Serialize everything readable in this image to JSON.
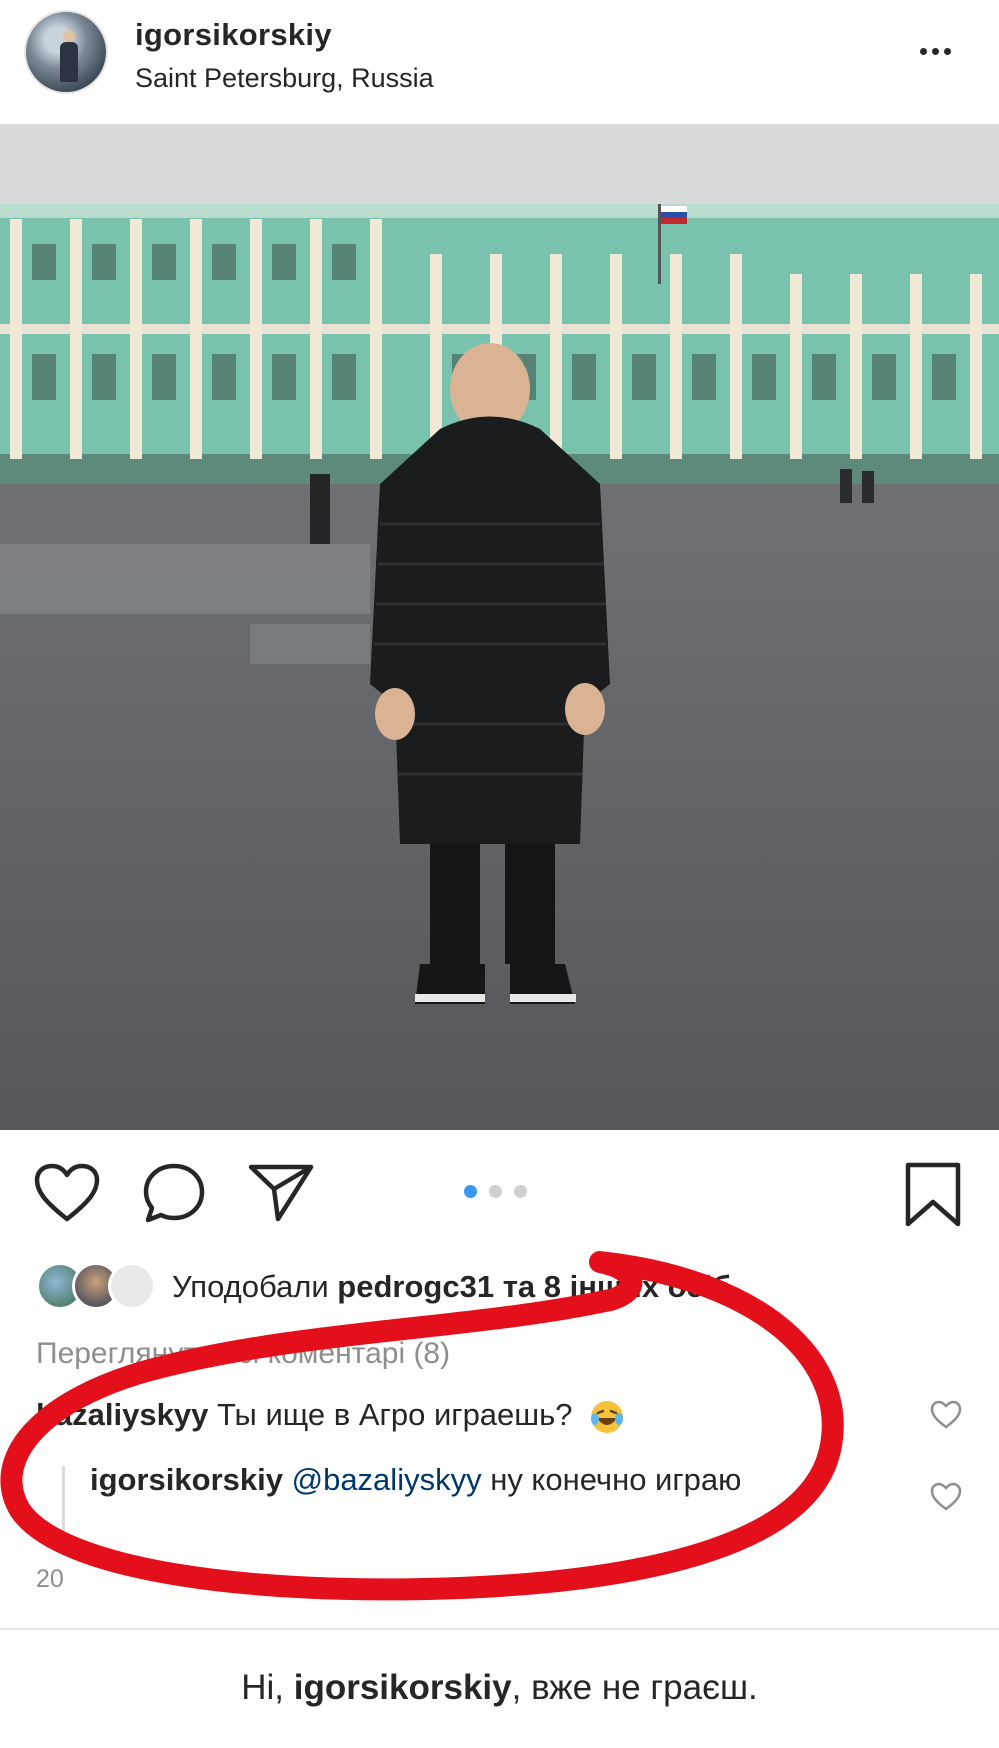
{
  "post": {
    "username": "igorsikorskiy",
    "location": "Saint Petersburg, Russia"
  },
  "icons": {
    "more": "more-options-icon",
    "like": "heart-icon",
    "comment": "comment-bubble-icon",
    "share": "paper-plane-icon",
    "save": "bookmark-icon",
    "emoji": "laughing-tears-emoji-icon"
  },
  "carousel": {
    "count": 3,
    "active": 1
  },
  "likes": {
    "prefix": "Уподобали",
    "user": "pedrogc31",
    "suffix": "та 8 інших осіб"
  },
  "view_comments": "Переглянути всі коментарі (8)",
  "comments": [
    {
      "user": "bazaliyskyy",
      "text": "Ты ище в Агро играешь?"
    },
    {
      "user": "igorsikorskiy",
      "mention": "@bazaliyskyy",
      "text": "ну конечно играю"
    }
  ],
  "timestamp": "20",
  "caption": {
    "prefix": "Ні,",
    "user": "igorsikorskiy",
    "suffix": ", вже не граєш."
  },
  "colors": {
    "accent": "#3897f0",
    "annotation": "#e3101b",
    "text": "#262626",
    "muted": "#8e8e8e",
    "palace": "#6fbfa8"
  }
}
